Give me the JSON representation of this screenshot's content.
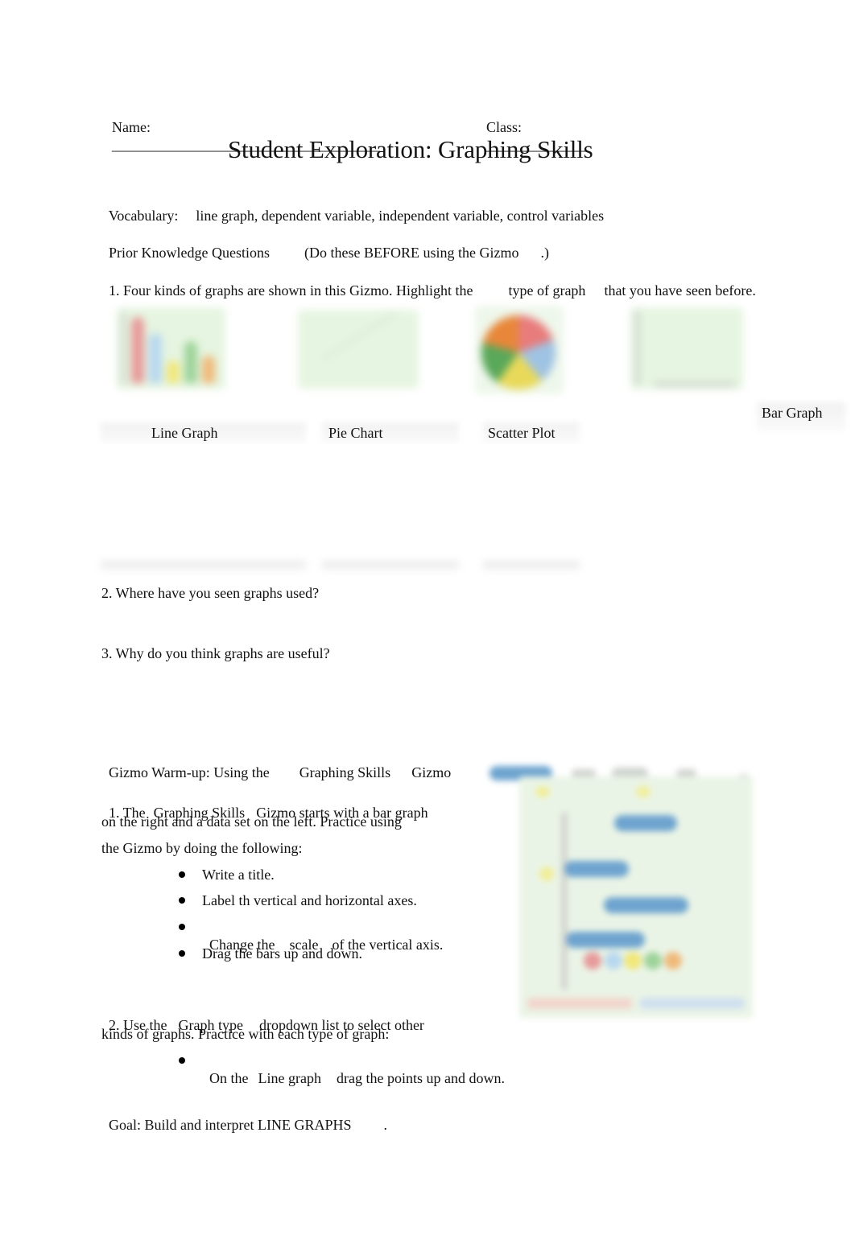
{
  "header": {
    "name_label": "Name:",
    "name_blank": "_____________________________________",
    "class_label": "Class:",
    "class_blank": "______________"
  },
  "title": "Student Exploration: Graphing Skills",
  "vocabulary": {
    "label": "Vocabulary:",
    "terms": "line graph, dependent variable, independent variable, control variables"
  },
  "prior_knowledge": {
    "heading": "Prior Knowledge Questions",
    "note_before": "(Do these BEFORE using the Gizmo",
    "note_after": ".)",
    "q1": {
      "part1": "1. Four kinds of graphs are shown in this Gizmo. Highlight the",
      "part2": "type of graph",
      "part3": "that you have seen before."
    },
    "graph_thumbnails": [
      {
        "icon": "bar-graph-thumbnail"
      },
      {
        "icon": "line-graph-thumbnail"
      },
      {
        "icon": "pie-chart-thumbnail"
      },
      {
        "icon": "scatter-plot-thumbnail"
      }
    ],
    "graph_labels": [
      "Line Graph",
      "Pie Chart",
      "Scatter Plot",
      "Bar Graph"
    ],
    "q2": "2. Where have you seen graphs used?",
    "q3": "3. Why do you think graphs are useful?"
  },
  "warmup": {
    "heading_part1": "Gizmo Warm-up: Using the",
    "heading_part2": "Graphing Skills",
    "heading_part3": "Gizmo",
    "step1": {
      "line1_a": "1. The",
      "line1_b": "Graphing Skills",
      "line1_c": "Gizmo starts with a bar graph",
      "line2": "on the right and a data set on the left. Practice using",
      "line3": "the Gizmo by doing the following:",
      "bullets": [
        {
          "text": "Write a title."
        },
        {
          "text": "Label th vertical and horizontal axes."
        },
        {
          "a": "Change the",
          "b": "scale",
          "c": "of the vertical axis."
        },
        {
          "text": "Drag the bars up and down."
        }
      ]
    },
    "step2": {
      "line1_a": "2. Use the",
      "line1_b": "Graph type",
      "line1_c": "dropdown list to select other",
      "line2": "kinds of graphs. Practice with each type of graph:",
      "bullet": {
        "a": "On the",
        "b": "Line graph",
        "c": "drag the points up and down."
      }
    },
    "gizmo_screenshot": {
      "icon": "gizmo-screenshot-image"
    }
  },
  "goal": {
    "text": "Goal: Build and interpret LINE GRAPHS",
    "end": "."
  },
  "colors": {
    "thumbnail_bg": "#e6f5e1",
    "bar_colors": [
      "#e79a9a",
      "#b8d8ef",
      "#f1e77a",
      "#9ed39a",
      "#f0b97a"
    ],
    "pie_colors": [
      "#e8873a",
      "#e87c7c",
      "#9fc3e3",
      "#e9d95a",
      "#5aa85a"
    ],
    "gizmo_pill": "#6ea4cf"
  }
}
